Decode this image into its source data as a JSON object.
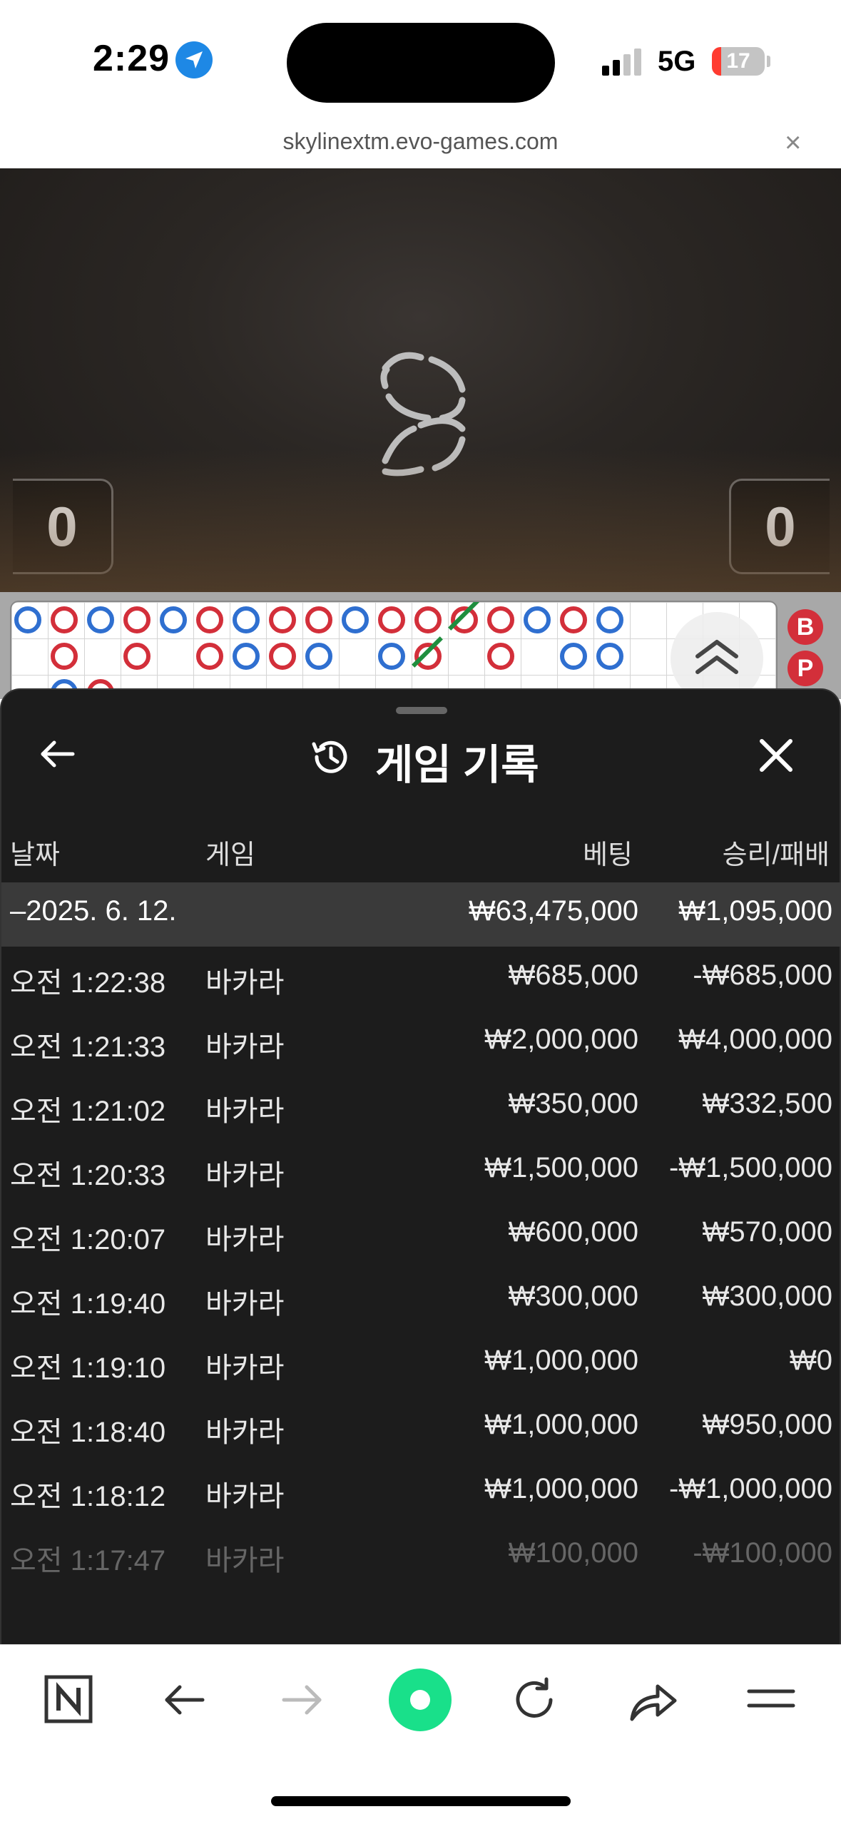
{
  "status_bar": {
    "time": "2:29",
    "network": "5G",
    "battery": "17",
    "battery_level": 0.17
  },
  "browser": {
    "url": "skylinextm.evo-games.com"
  },
  "video": {
    "left_score": "0",
    "right_score": "0"
  },
  "side_road": {
    "chips": [
      "B",
      "P"
    ]
  },
  "sheet": {
    "title": "게임 기록",
    "columns": {
      "date": "날짜",
      "game": "게임",
      "bet": "베팅",
      "win_loss": "승리/패배"
    },
    "group": {
      "date": "–2025. 6. 12.",
      "bet": "₩63,475,000",
      "win_loss": "₩1,095,000"
    },
    "rows": [
      {
        "time": "오전 1:22:38",
        "game": "바카라",
        "bet": "₩685,000",
        "win_loss": "-₩685,000"
      },
      {
        "time": "오전 1:21:33",
        "game": "바카라",
        "bet": "₩2,000,000",
        "win_loss": "₩4,000,000"
      },
      {
        "time": "오전 1:21:02",
        "game": "바카라",
        "bet": "₩350,000",
        "win_loss": "₩332,500"
      },
      {
        "time": "오전 1:20:33",
        "game": "바카라",
        "bet": "₩1,500,000",
        "win_loss": "-₩1,500,000"
      },
      {
        "time": "오전 1:20:07",
        "game": "바카라",
        "bet": "₩600,000",
        "win_loss": "₩570,000"
      },
      {
        "time": "오전 1:19:40",
        "game": "바카라",
        "bet": "₩300,000",
        "win_loss": "₩300,000"
      },
      {
        "time": "오전 1:19:10",
        "game": "바카라",
        "bet": "₩1,000,000",
        "win_loss": "₩0"
      },
      {
        "time": "오전 1:18:40",
        "game": "바카라",
        "bet": "₩1,000,000",
        "win_loss": "₩950,000"
      },
      {
        "time": "오전 1:18:12",
        "game": "바카라",
        "bet": "₩1,000,000",
        "win_loss": "-₩1,000,000"
      },
      {
        "time": "오전 1:17:47",
        "game": "바카라",
        "bet": "₩100,000",
        "win_loss": "-₩100,000"
      }
    ]
  },
  "toolbar": {
    "icons": [
      "naver-icon",
      "back-arrow-icon",
      "forward-arrow-icon",
      "green-dot-icon",
      "reload-icon",
      "share-icon",
      "menu-icon"
    ],
    "accent": "#19e08a"
  }
}
